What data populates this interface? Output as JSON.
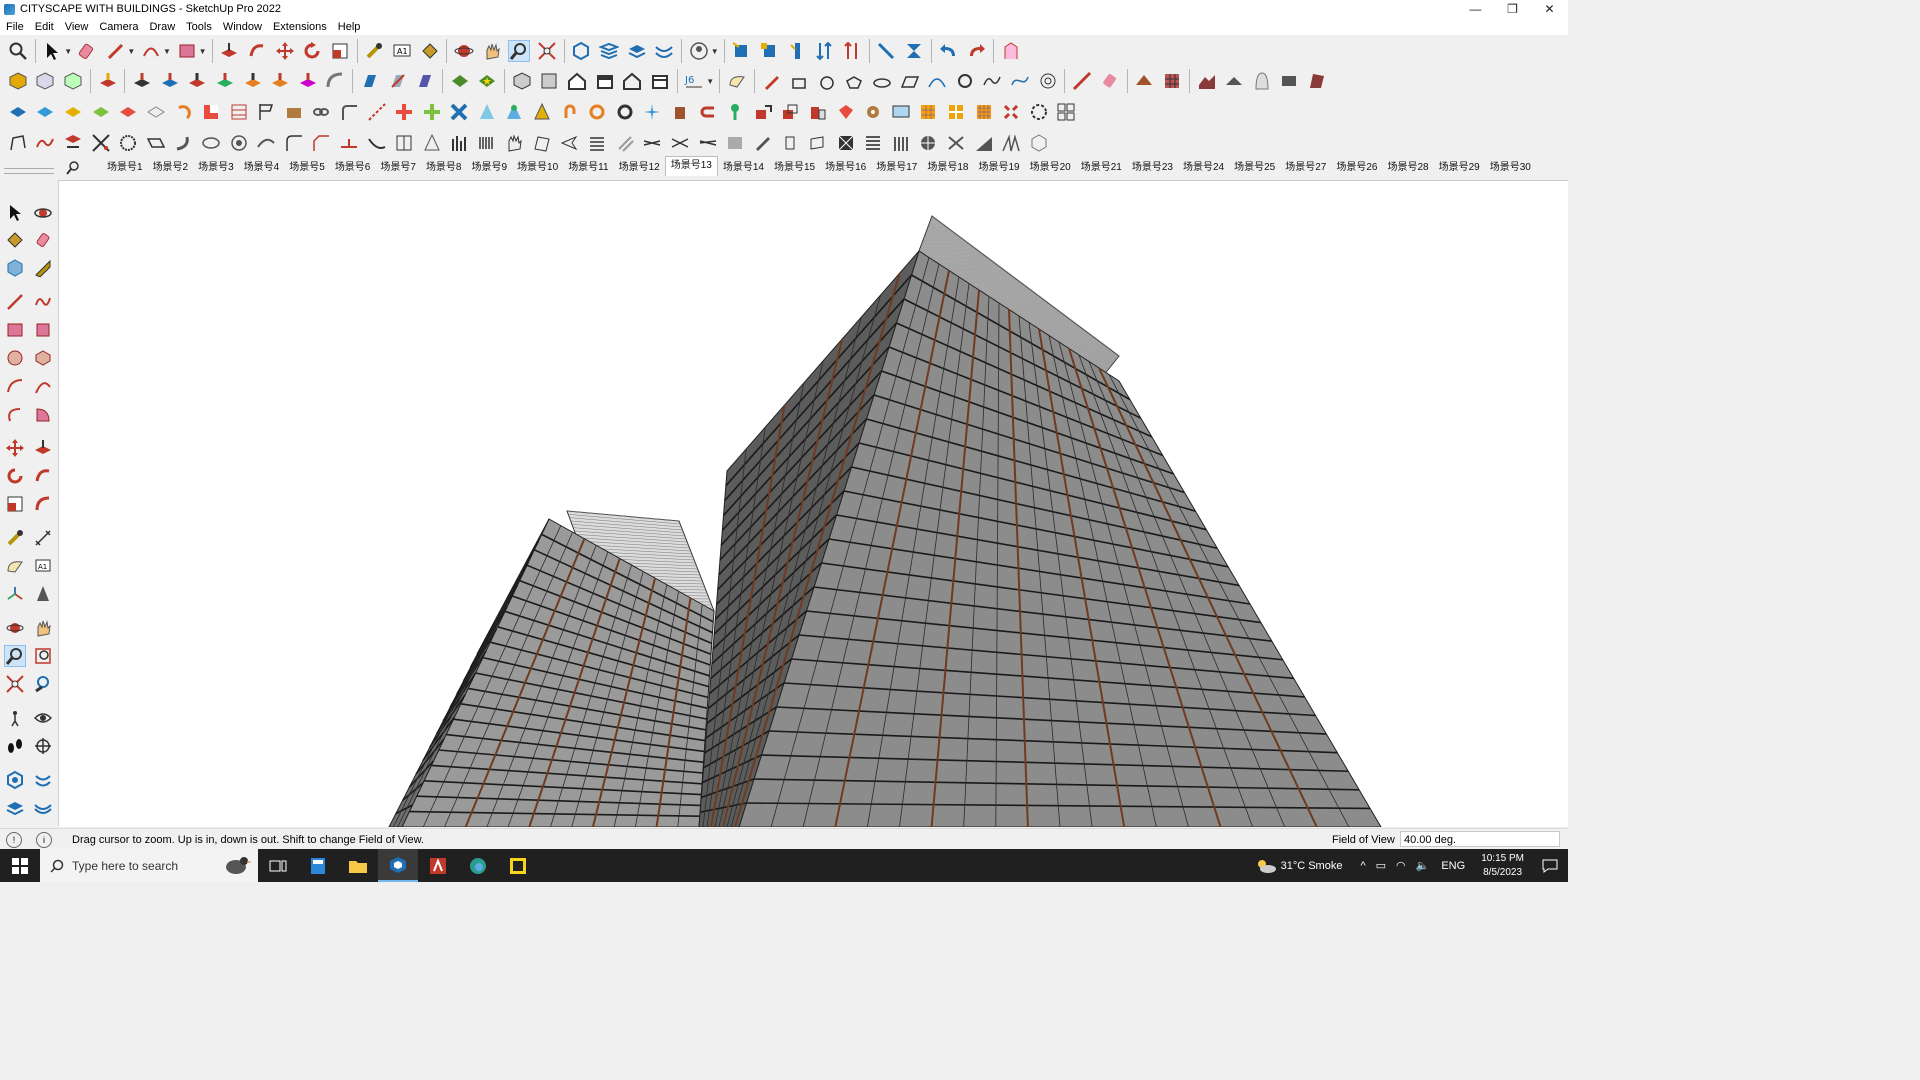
{
  "window": {
    "title": "CITYSCAPE WITH BUILDINGS - SketchUp Pro 2022",
    "buttons": [
      "—",
      "❐",
      "✕"
    ]
  },
  "menu": [
    "File",
    "Edit",
    "View",
    "Camera",
    "Draw",
    "Tools",
    "Window",
    "Extensions",
    "Help"
  ],
  "scenes": {
    "active_index": 12,
    "tabs": [
      "场景号1",
      "场景号2",
      "场景号3",
      "场景号4",
      "场景号5",
      "场景号6",
      "场景号7",
      "场景号8",
      "场景号9",
      "场景号10",
      "场景号11",
      "场景号12",
      "场景号13",
      "场景号14",
      "场景号15",
      "场景号16",
      "场景号17",
      "场景号18",
      "场景号19",
      "场景号20",
      "场景号21",
      "场景号23",
      "场景号24",
      "场景号25",
      "场景号27",
      "场景号26",
      "场景号28",
      "场景号29",
      "场景号30"
    ]
  },
  "status": {
    "message": "Drag cursor to zoom.  Up is in, down is out. Shift to change Field of View.",
    "measure_label": "Field of View",
    "measure_value": "40.00 deg."
  },
  "taskbar": {
    "search_placeholder": "Type here to search",
    "weather": "31°C  Smoke",
    "language": "ENG",
    "time": "10:15 PM",
    "date": "8/5/2023"
  },
  "colors": {
    "accent": "#1f6fb2",
    "active_tool": "#cde3f7",
    "facade_dark": "#555555",
    "facade_light": "#9a9a9a",
    "mullion_brown": "#6e3b20"
  }
}
